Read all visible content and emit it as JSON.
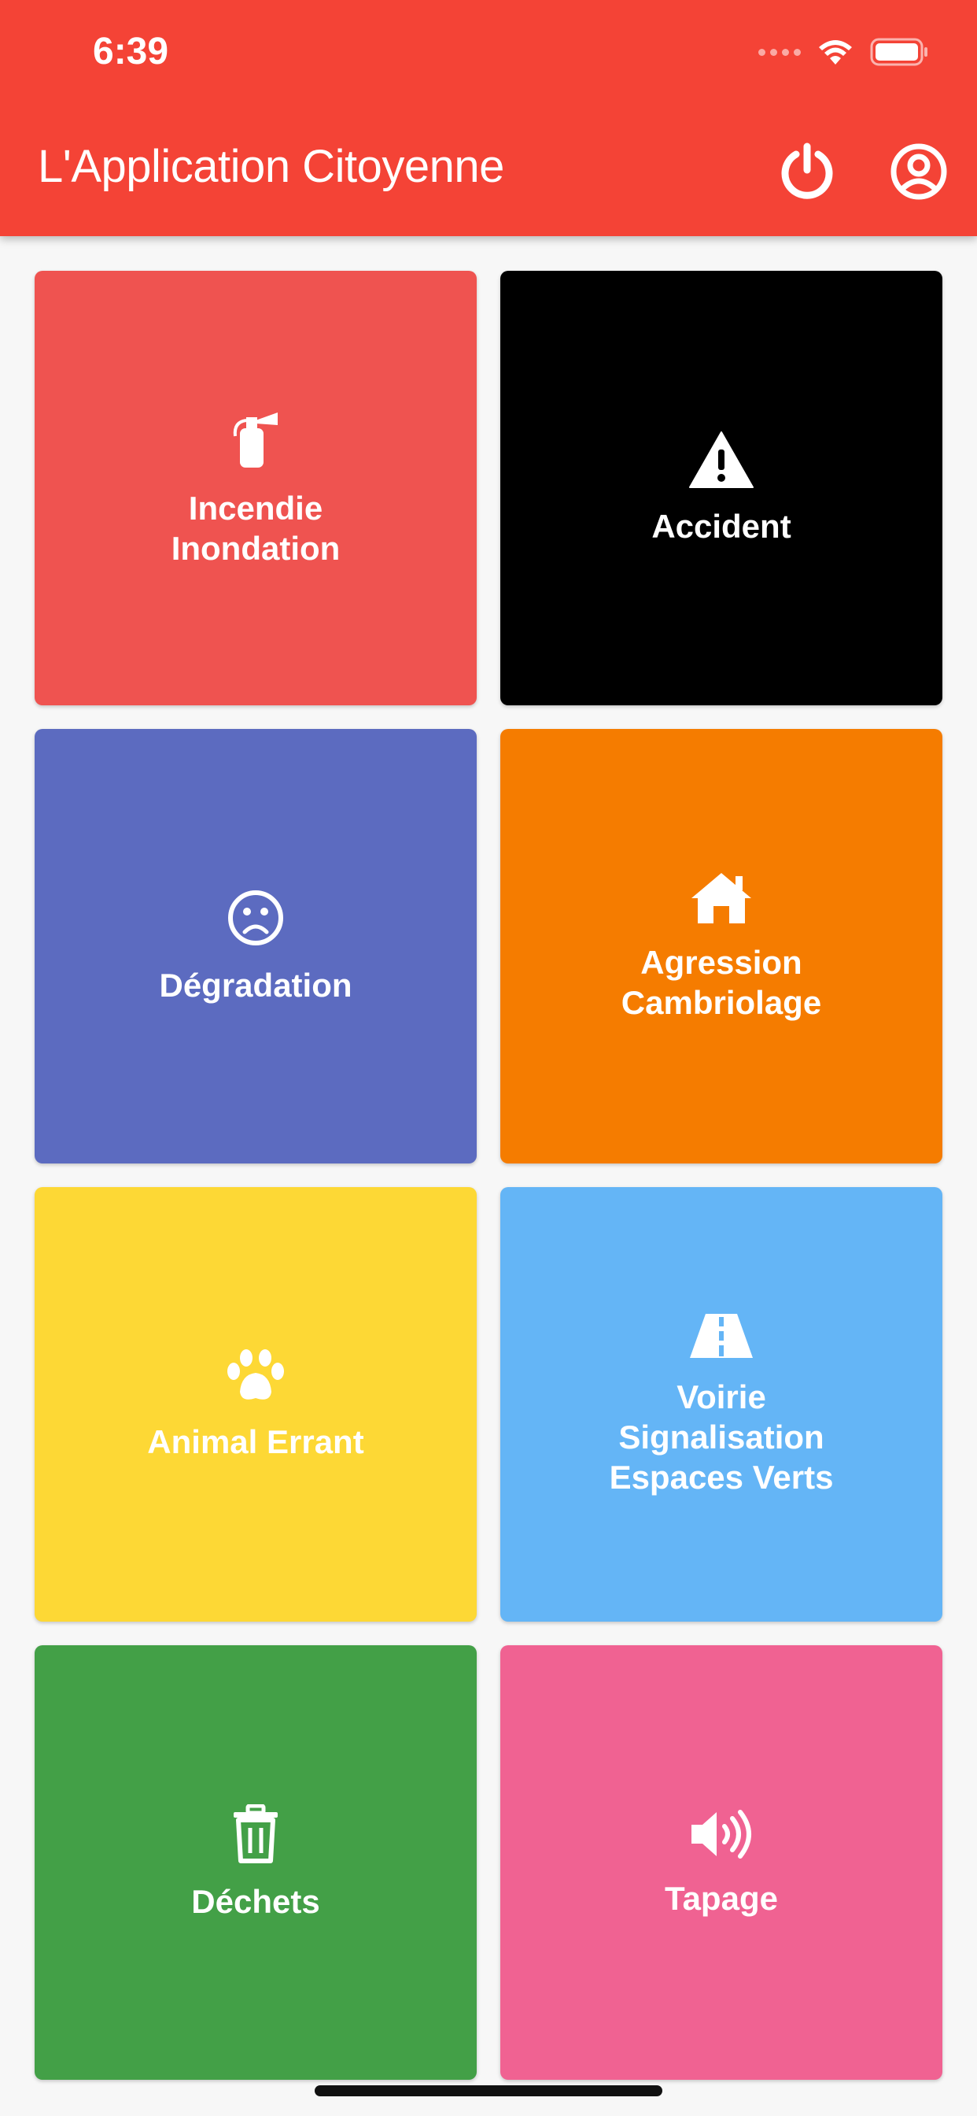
{
  "status_bar": {
    "time": "6:39"
  },
  "header": {
    "title": "L'Application Citoyenne",
    "background": "#f44336",
    "power_icon": "power-icon",
    "account_icon": "account-circle-icon"
  },
  "tiles": [
    {
      "label": "Incendie\nInondation",
      "icon": "fire-extinguisher-icon",
      "color": "#ef5350"
    },
    {
      "label": "Accident",
      "icon": "warning-icon",
      "color": "#000000"
    },
    {
      "label": "Dégradation",
      "icon": "frown-icon",
      "color": "#5c6bc0"
    },
    {
      "label": "Agression\nCambriolage",
      "icon": "home-icon",
      "color": "#f57c00"
    },
    {
      "label": "Animal Errant",
      "icon": "paw-icon",
      "color": "#fdd835"
    },
    {
      "label": "Voirie\nSignalisation\nEspaces Verts",
      "icon": "road-icon",
      "color": "#64b5f6"
    },
    {
      "label": "Déchets",
      "icon": "trash-icon",
      "color": "#43a047"
    },
    {
      "label": "Tapage",
      "icon": "volume-icon",
      "color": "#f06292"
    }
  ]
}
